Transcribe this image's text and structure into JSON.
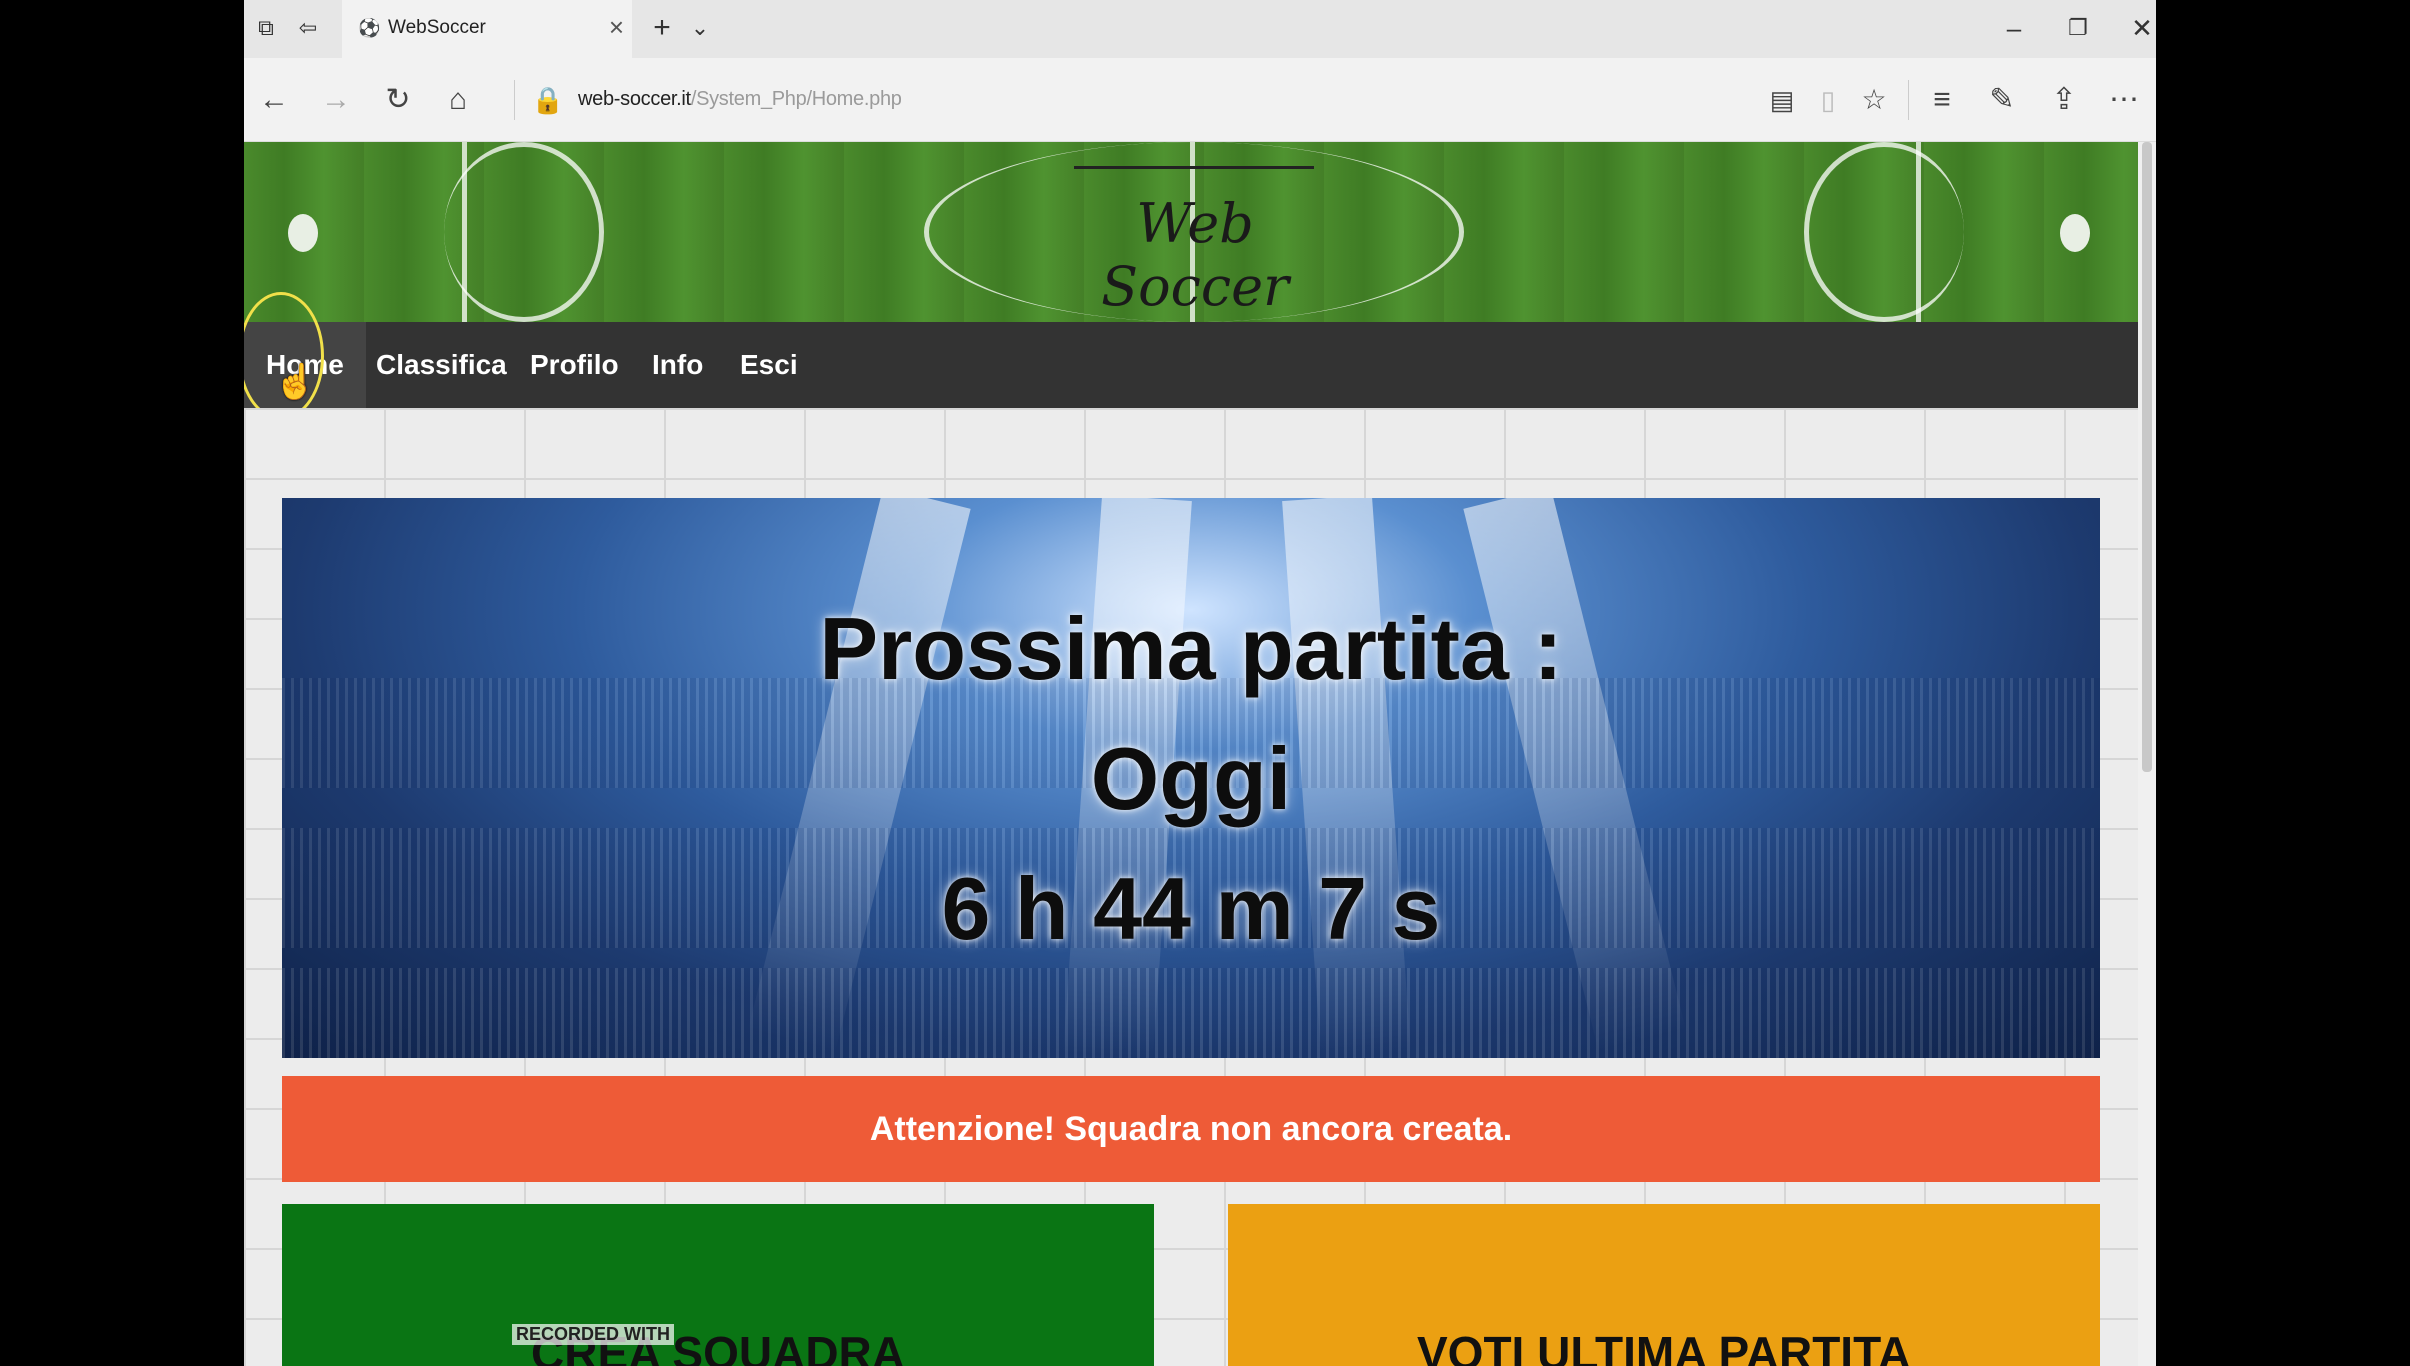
{
  "browser": {
    "tab_title": "WebSoccer",
    "url_domain": "web-soccer.it",
    "url_path": "/System_Php/Home.php"
  },
  "site": {
    "logo": "Web Soccer",
    "menu": [
      "Home",
      "Classifica",
      "Profilo",
      "Info",
      "Esci"
    ],
    "active_menu": "Home"
  },
  "hero": {
    "line1": "Prossima partita :",
    "line2": "Oggi",
    "countdown": "6 h 44 m 7 s"
  },
  "alert": "Attenzione! Squadra non ancora creata.",
  "cards": {
    "left": "CREA SQUADRA",
    "right": "VOTI ULTIMA PARTITA"
  },
  "watermark": "RECORDED WITH",
  "colors": {
    "alert": "#ee5b37",
    "card_left": "#0a7514",
    "card_right": "#eba012",
    "menu_bg": "#333333"
  }
}
